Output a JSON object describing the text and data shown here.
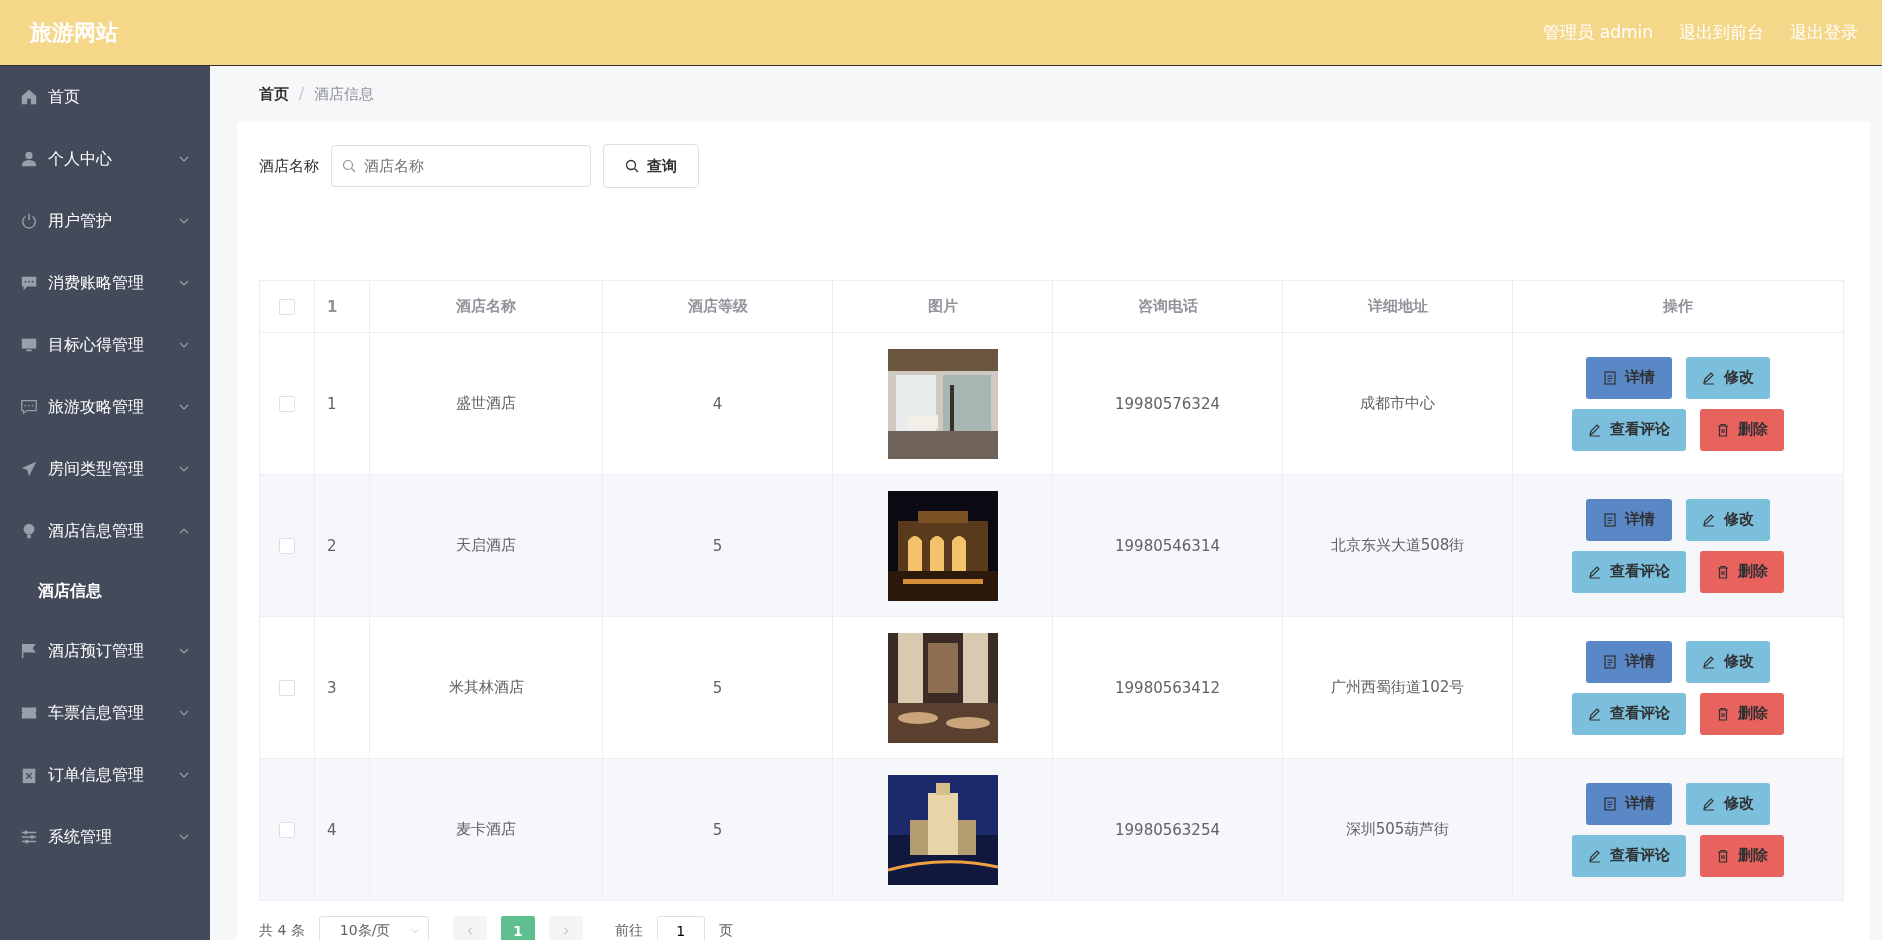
{
  "header": {
    "title": "旅游网站",
    "links": [
      "管理员 admin",
      "退出到前台",
      "退出登录"
    ]
  },
  "sidebar": {
    "items": [
      {
        "label": "首页"
      },
      {
        "label": "个人中心",
        "expanded": false
      },
      {
        "label": "用户管护",
        "expanded": false
      },
      {
        "label": "消费账略管理",
        "expanded": false
      },
      {
        "label": "目标心得管理",
        "expanded": false
      },
      {
        "label": "旅游攻略管理",
        "expanded": false
      },
      {
        "label": "房间类型管理",
        "expanded": false
      },
      {
        "label": "酒店信息管理",
        "expanded": true,
        "children": [
          {
            "label": "酒店信息",
            "selected": true
          }
        ]
      },
      {
        "label": "酒店预订管理",
        "expanded": false
      },
      {
        "label": "车票信息管理",
        "expanded": false
      },
      {
        "label": "订单信息管理",
        "expanded": false
      },
      {
        "label": "系统管理",
        "expanded": false
      }
    ]
  },
  "breadcrumb": {
    "items": [
      "首页",
      "酒店信息"
    ],
    "separator": "/"
  },
  "search": {
    "label": "酒店名称",
    "placeholder": "酒店名称",
    "button": "查询"
  },
  "table": {
    "header_checked": false,
    "columns": [
      "1",
      "酒店名称",
      "酒店等级",
      "图片",
      "咨询电话",
      "详细地址",
      "操作"
    ],
    "rows": [
      {
        "checked": false,
        "index": "1",
        "name": "盛世酒店",
        "level": "4",
        "phone": "19980576324",
        "address": "成都市中心",
        "actions": [
          {
            "kind": "detail",
            "label": "详情"
          },
          {
            "kind": "edit",
            "label": "修改"
          },
          {
            "kind": "comments",
            "label": "查看评论"
          },
          {
            "kind": "delete",
            "label": "删除"
          }
        ]
      },
      {
        "checked": false,
        "index": "2",
        "name": "天启酒店",
        "level": "5",
        "phone": "19980546314",
        "address": "北京东兴大道508街",
        "actions": [
          {
            "kind": "detail",
            "label": "详情"
          },
          {
            "kind": "edit",
            "label": "修改"
          },
          {
            "kind": "comments",
            "label": "查看评论"
          },
          {
            "kind": "delete",
            "label": "删除"
          }
        ]
      },
      {
        "checked": false,
        "index": "3",
        "name": "米其林酒店",
        "level": "5",
        "phone": "19980563412",
        "address": "广州西蜀街道102号",
        "actions": [
          {
            "kind": "detail",
            "label": "详情"
          },
          {
            "kind": "edit",
            "label": "修改"
          },
          {
            "kind": "comments",
            "label": "查看评论"
          },
          {
            "kind": "delete",
            "label": "删除"
          }
        ]
      },
      {
        "checked": false,
        "index": "4",
        "name": "麦卡酒店",
        "level": "5",
        "phone": "19980563254",
        "address": "深圳505葫芦街",
        "actions": [
          {
            "kind": "detail",
            "label": "详情"
          },
          {
            "kind": "edit",
            "label": "修改"
          },
          {
            "kind": "comments",
            "label": "查看评论"
          },
          {
            "kind": "delete",
            "label": "删除"
          }
        ]
      }
    ]
  },
  "pagination": {
    "total": "共 4 条",
    "page_size": "10条/页",
    "pages": [
      {
        "label": "1",
        "selected": true
      }
    ],
    "goto_label": "前往",
    "goto_value": "1",
    "goto_suffix": "页"
  }
}
